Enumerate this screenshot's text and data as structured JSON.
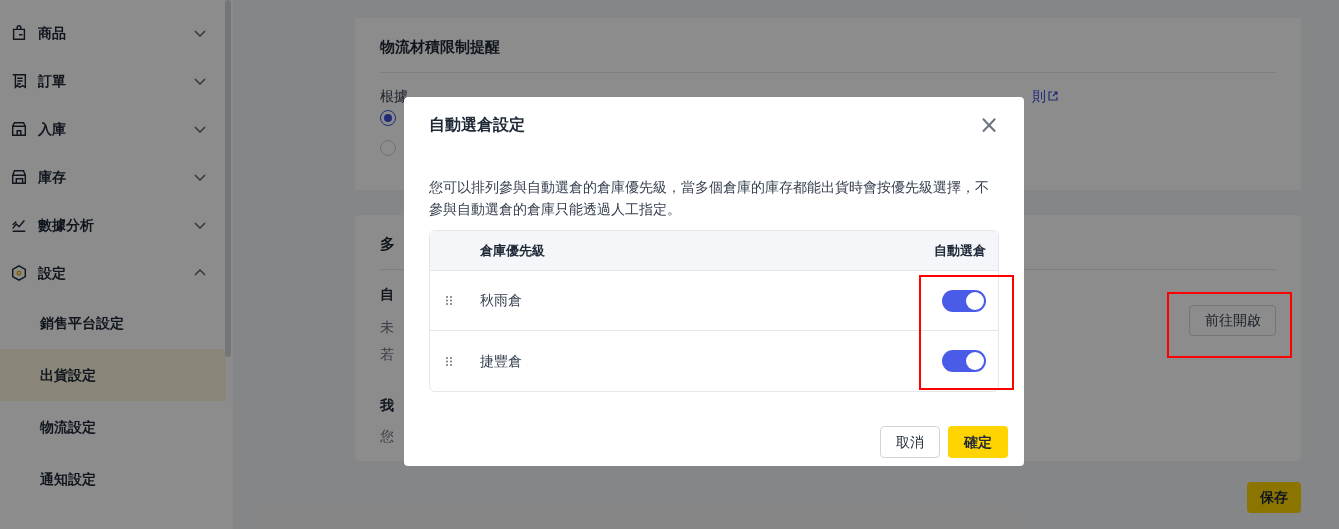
{
  "sidebar": {
    "items": [
      {
        "label": "商品",
        "expanded": false
      },
      {
        "label": "訂單",
        "expanded": false
      },
      {
        "label": "入庫",
        "expanded": false
      },
      {
        "label": "庫存",
        "expanded": false
      },
      {
        "label": "數據分析",
        "expanded": false
      },
      {
        "label": "設定",
        "expanded": true,
        "children": [
          {
            "label": "銷售平台設定",
            "selected": false
          },
          {
            "label": "出貨設定",
            "selected": true
          },
          {
            "label": "物流設定",
            "selected": false
          },
          {
            "label": "通知設定",
            "selected": false
          }
        ]
      }
    ]
  },
  "volume_card": {
    "title": "物流材積限制提醒",
    "text_start": "根據",
    "link": "則",
    "radios": [
      {
        "selected": true
      },
      {
        "selected": false
      }
    ]
  },
  "warehouse_card": {
    "title": "多",
    "auto_title": "自",
    "line_1": "未",
    "line_2": "若",
    "mine_title": "我",
    "mine_text": "您",
    "open_button": "前往開啟"
  },
  "save_button": "保存",
  "dialog": {
    "title": "自動選倉設定",
    "close": "×",
    "description": "您可以排列參與自動選倉的倉庫優先級，當多個倉庫的庫存都能出貨時會按優先級選擇，不參與自動選倉的倉庫只能透過人工指定。",
    "columns": [
      "倉庫優先級",
      "自動選倉"
    ],
    "rows": [
      {
        "name": "秋雨倉",
        "on": true
      },
      {
        "name": "捷豐倉",
        "on": true
      }
    ],
    "cancel": "取消",
    "confirm": "確定"
  }
}
